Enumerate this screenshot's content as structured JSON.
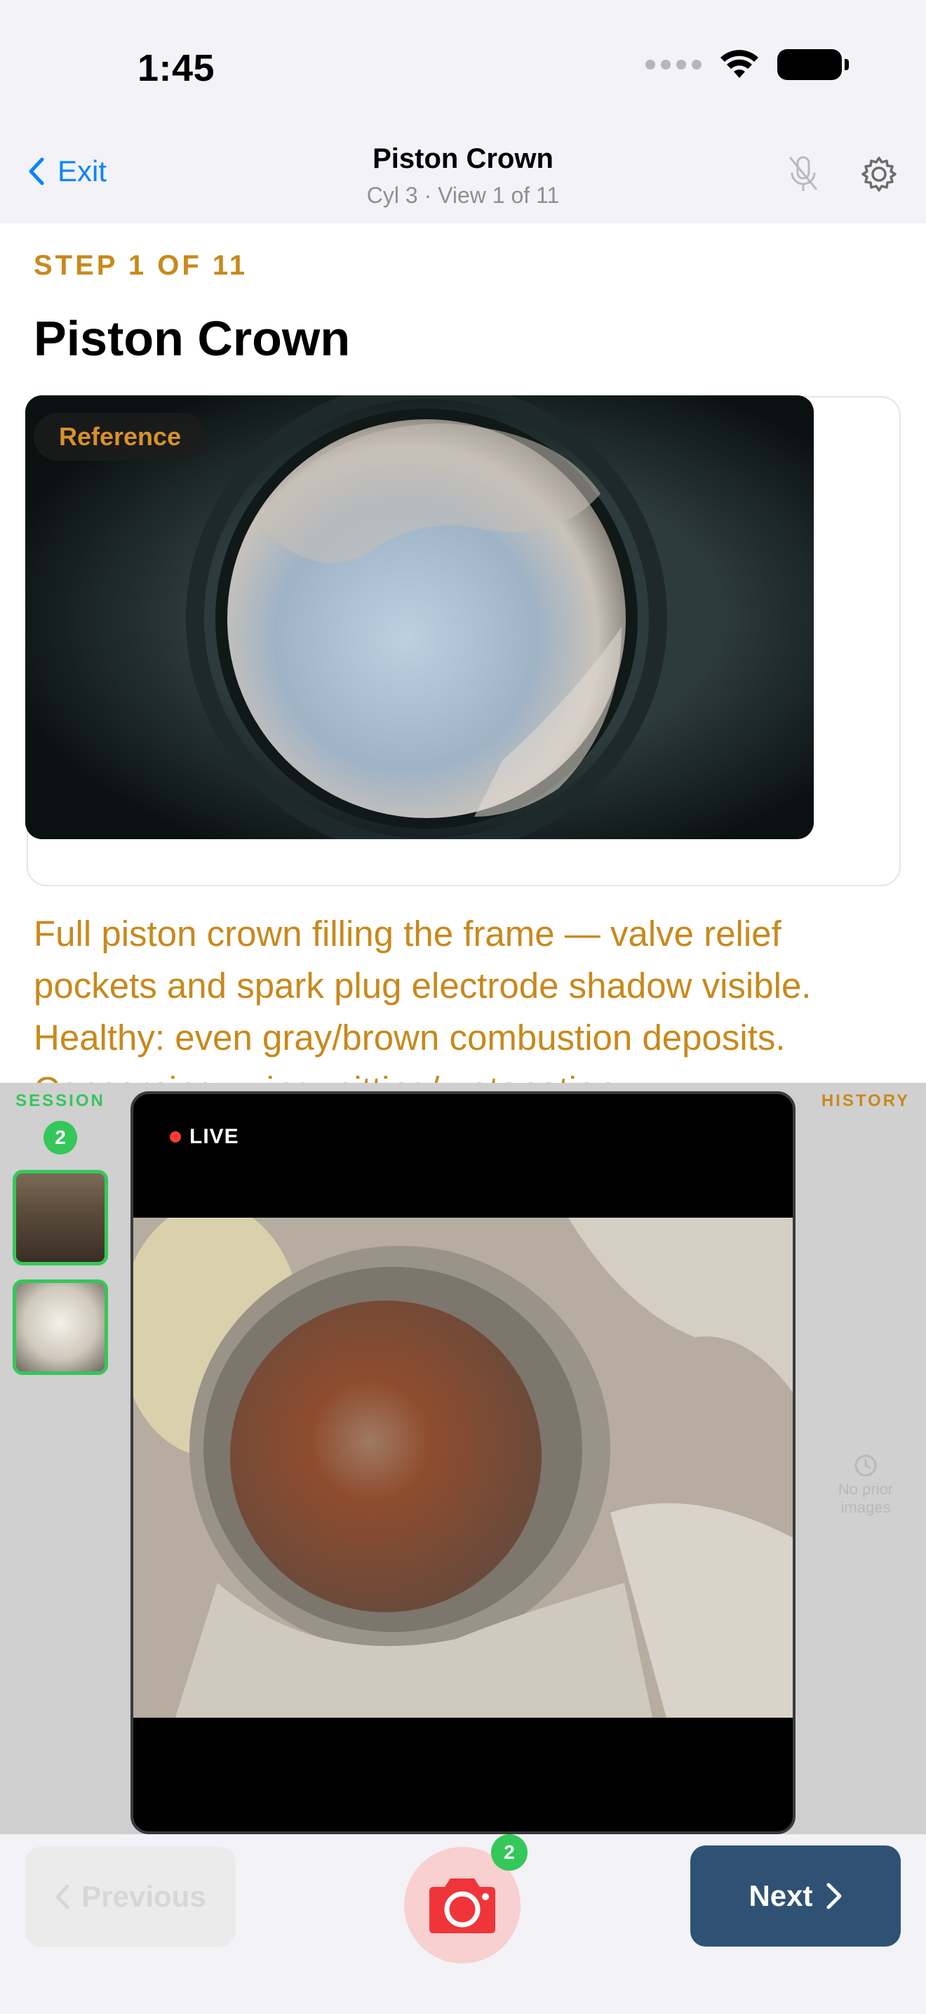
{
  "status_bar": {
    "time": "1:45"
  },
  "nav": {
    "back_label": "Exit",
    "title": "Piston Crown",
    "subtitle": "Cyl 3 · View 1 of 11"
  },
  "step": {
    "label": "STEP 1 OF 11",
    "title": "Piston Crown",
    "reference_badge": "Reference",
    "description": "Full piston crown filling the frame — valve relief pockets and spark plug electrode shadow visible. Healthy: even gray/brown combustion deposits. Concerning: ...ing, pitting/...etonation..."
  },
  "capture_panel": {
    "session_label": "SESSION",
    "session_count": "2",
    "live_label": "LIVE",
    "history_label": "HISTORY",
    "history_empty": "No prior images"
  },
  "bottom_bar": {
    "previous_label": "Previous",
    "capture_count": "2",
    "next_label": "Next"
  },
  "colors": {
    "accent_orange": "#c8891c",
    "link_blue": "#0a84ff",
    "session_green": "#34c759",
    "live_red": "#ff3b30",
    "next_button": "#2f5274"
  }
}
